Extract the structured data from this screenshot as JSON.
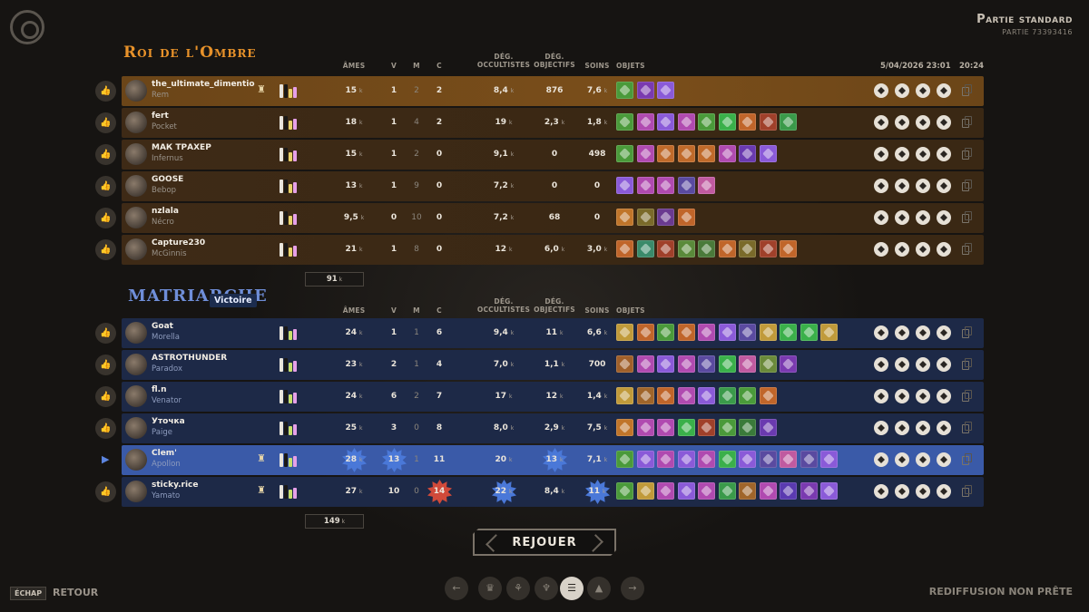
{
  "header": {
    "mode_title": "Partie standard",
    "match_id": "PARTIE 73393416",
    "date": "5/04/2026 23:01",
    "duration": "20:24"
  },
  "columns": {
    "souls": "ÂMES",
    "kills": "V",
    "deaths": "M",
    "assists": "C",
    "occult_dmg": "DÉG. OCCULTISTES",
    "obj_dmg": "DÉG. OBJECTIFS",
    "heal": "SOINS",
    "items": "OBJETS",
    "unit": "k"
  },
  "team_top": {
    "name": "Roi de l'Ombre",
    "souls_total": "91",
    "players": [
      {
        "name": "the_ultimate_dimentio",
        "hero": "Rem",
        "rank": true,
        "souls": "15",
        "k": "1",
        "d": "2",
        "a": "2",
        "occ": "8,4",
        "occ_k": true,
        "obj": "876",
        "obj_k": false,
        "heal": "7,6",
        "heal_k": true,
        "items": [
          "#4a9a3a",
          "#7a3ab0",
          "#8a5ad8"
        ]
      },
      {
        "name": "fert",
        "hero": "Pocket",
        "rank": false,
        "souls": "18",
        "k": "1",
        "d": "4",
        "a": "2",
        "occ": "19",
        "occ_k": true,
        "obj": "2,3",
        "obj_k": true,
        "heal": "1,8",
        "heal_k": true,
        "items": [
          "#4a9a3a",
          "#b04ab0",
          "#8a5ad8",
          "#b04ab0",
          "#4a9a3a",
          "#3ab04a",
          "#c0652a",
          "#a0402a",
          "#3a9a4a"
        ]
      },
      {
        "name": "МАК ТРАХЕР",
        "hero": "Infernus",
        "rank": false,
        "souls": "15",
        "k": "1",
        "d": "2",
        "a": "0",
        "occ": "9,1",
        "occ_k": true,
        "obj": "0",
        "obj_k": false,
        "heal": "498",
        "heal_k": false,
        "items": [
          "#4a9a3a",
          "#b04ab0",
          "#c06a2a",
          "#c06a2a",
          "#c06a2a",
          "#b04ab0",
          "#6a3ab0",
          "#8a5ad8"
        ]
      },
      {
        "name": "GOOSE",
        "hero": "Bebop",
        "rank": false,
        "souls": "13",
        "k": "1",
        "d": "9",
        "a": "0",
        "occ": "7,2",
        "occ_k": true,
        "obj": "0",
        "obj_k": false,
        "heal": "0",
        "heal_k": false,
        "items": [
          "#8a5ad8",
          "#b04ab0",
          "#b04ab0",
          "#5a4aa0",
          "#c05aa0"
        ]
      },
      {
        "name": "nzlala",
        "hero": "Nécro",
        "rank": false,
        "souls": "9,5",
        "k": "0",
        "d": "10",
        "a": "0",
        "occ": "7,2",
        "occ_k": true,
        "obj": "68",
        "obj_k": false,
        "heal": "0",
        "heal_k": false,
        "items": [
          "#c0752a",
          "#7a6a2a",
          "#6a3a90",
          "#c0652a"
        ]
      },
      {
        "name": "Capture230",
        "hero": "McGinnis",
        "rank": false,
        "souls": "21",
        "k": "1",
        "d": "8",
        "a": "0",
        "occ": "12",
        "occ_k": true,
        "obj": "6,0",
        "obj_k": true,
        "heal": "3,0",
        "heal_k": true,
        "items": [
          "#c0652a",
          "#3a8a6a",
          "#a0402a",
          "#5a8a3a",
          "#4a7a3a",
          "#c0652a",
          "#7a6a2a",
          "#a0402a",
          "#c0652a"
        ]
      }
    ]
  },
  "team_bottom": {
    "name": "MATRIARCHE",
    "result": "Victoire",
    "souls_total": "149",
    "players": [
      {
        "name": "Goat",
        "hero": "Morella",
        "rank": false,
        "souls": "24",
        "k": "1",
        "d": "1",
        "a": "6",
        "occ": "9,4",
        "occ_k": true,
        "obj": "11",
        "obj_k": true,
        "heal": "6,6",
        "heal_k": true,
        "items": [
          "#c09a3a",
          "#c0652a",
          "#4a9a3a",
          "#c0652a",
          "#b04ab0",
          "#8a5ad8",
          "#5a4aa0",
          "#c09a3a",
          "#3ab04a",
          "#3ab04a",
          "#c09a3a"
        ]
      },
      {
        "name": "ASTROTHUNDER",
        "hero": "Paradox",
        "rank": false,
        "souls": "23",
        "k": "2",
        "d": "1",
        "a": "4",
        "occ": "7,0",
        "occ_k": true,
        "obj": "1,1",
        "obj_k": true,
        "heal": "700",
        "heal_k": false,
        "items": [
          "#a0602a",
          "#b04ab0",
          "#8a5ad8",
          "#b04ab0",
          "#5a4aa0",
          "#3ab04a",
          "#c05aa0",
          "#6a8a3a",
          "#7a3ab0"
        ]
      },
      {
        "name": "fl.n",
        "hero": "Venator",
        "rank": false,
        "souls": "24",
        "k": "6",
        "d": "2",
        "a": "7",
        "occ": "17",
        "occ_k": true,
        "obj": "12",
        "obj_k": true,
        "heal": "1,4",
        "heal_k": true,
        "items": [
          "#c09a3a",
          "#a0652a",
          "#c0652a",
          "#b04ab0",
          "#8a5ad8",
          "#3a9a4a",
          "#4a9a3a",
          "#c0652a"
        ]
      },
      {
        "name": "Уточка",
        "hero": "Paige",
        "rank": false,
        "souls": "25",
        "k": "3",
        "d": "0",
        "a": "8",
        "occ": "8,0",
        "occ_k": true,
        "obj": "2,9",
        "obj_k": true,
        "heal": "7,5",
        "heal_k": true,
        "items": [
          "#c0752a",
          "#b04ab0",
          "#b04ab0",
          "#3ab04a",
          "#a0402a",
          "#4a9a3a",
          "#3a7a3a",
          "#6a3ab0"
        ]
      },
      {
        "name": "Clem'",
        "hero": "Apollon",
        "rank": true,
        "souls": "28",
        "k": "13",
        "d": "1",
        "a": "11",
        "occ": "20",
        "occ_k": true,
        "obj": "13",
        "obj_k": true,
        "heal": "7,1",
        "heal_k": true,
        "highlight": true,
        "items": [
          "#4a9a3a",
          "#8a5ad8",
          "#b04ab0",
          "#8a5ad8",
          "#b04ab0",
          "#3ab04a",
          "#8a5ad8",
          "#5a4aa0",
          "#c05aa0",
          "#5a4aa0",
          "#8a5ad8"
        ]
      },
      {
        "name": "sticky.rice",
        "hero": "Yamato",
        "rank": true,
        "souls": "27",
        "k": "10",
        "d": "0",
        "a": "14",
        "occ": "22",
        "occ_k": true,
        "obj": "8,4",
        "obj_k": true,
        "heal": "11",
        "heal_k": true,
        "items": [
          "#4a9a3a",
          "#c09a3a",
          "#b04ab0",
          "#8a5ad8",
          "#b04ab0",
          "#3a9a4a",
          "#a0652a",
          "#b04ab0",
          "#5a3ab0",
          "#7a3ab0",
          "#8a5ad8"
        ]
      }
    ]
  },
  "buttons": {
    "replay": "REJOUER",
    "esc_key": "ÉCHAP",
    "back": "RETOUR",
    "replay_status": "REDIFFUSION NON PRÊTE"
  },
  "colors": {
    "top_team": "#e8922a",
    "bottom_team": "#6f8ed8",
    "burst_blue": "#4a78d8",
    "burst_red": "#d04a3a"
  }
}
